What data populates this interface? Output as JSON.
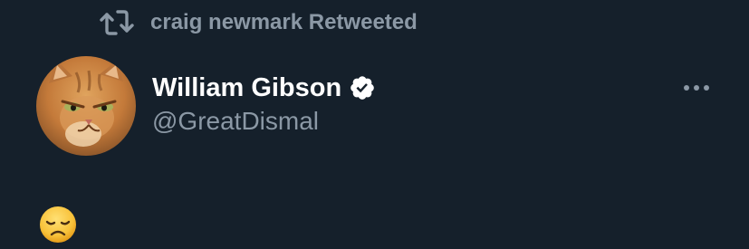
{
  "retweet": {
    "icon": "retweet-icon",
    "text": "craig newmark Retweeted"
  },
  "author": {
    "avatar_icon": "cat-avatar",
    "display_name": "William Gibson",
    "verified_icon": "verified-badge-icon",
    "handle": "@GreatDismal"
  },
  "menu": {
    "icon": "more-horizontal-icon"
  },
  "tweet": {
    "content_emoji": "disappointed-face-emoji"
  },
  "colors": {
    "background": "#15202b",
    "primary_text": "#ffffff",
    "secondary_text": "#8b98a5"
  }
}
